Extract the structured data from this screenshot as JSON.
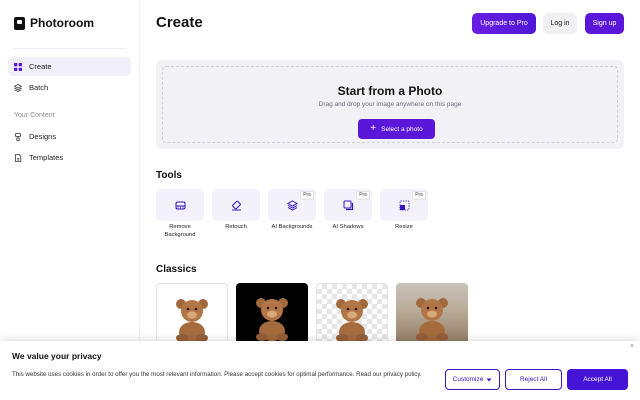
{
  "app": {
    "name": "Photoroom"
  },
  "sidebar": {
    "items": [
      {
        "label": "Create",
        "icon": "grid-icon",
        "active": true
      },
      {
        "label": "Batch",
        "icon": "layers-icon",
        "active": false
      }
    ],
    "section_label": "Your Content",
    "content_items": [
      {
        "label": "Designs",
        "icon": "designs-icon"
      },
      {
        "label": "Templates",
        "icon": "templates-icon"
      }
    ]
  },
  "header": {
    "title": "Create",
    "upgrade_label": "Upgrade to Pro",
    "login_label": "Log in",
    "signup_label": "Sign up"
  },
  "upload": {
    "title": "Start from a Photo",
    "subtitle": "Drag and drop your image anywhere on this page",
    "button_label": "Select a photo",
    "button_icon": "plus-icon"
  },
  "tools": {
    "title": "Tools",
    "pro_label": "Pro",
    "items": [
      {
        "label_line1": "Remove",
        "label_line2": "Background",
        "icon": "remove-background-icon",
        "pro": false
      },
      {
        "label_line1": "Retouch",
        "label_line2": "",
        "icon": "retouch-icon",
        "pro": false
      },
      {
        "label_line1": "AI Backgrounds",
        "label_line2": "",
        "icon": "ai-backgrounds-icon",
        "pro": true
      },
      {
        "label_line1": "AI Shadows",
        "label_line2": "",
        "icon": "ai-shadows-icon",
        "pro": true
      },
      {
        "label_line1": "Resize",
        "label_line2": "",
        "icon": "resize-icon",
        "pro": true
      }
    ]
  },
  "classics": {
    "title": "Classics",
    "items": [
      {
        "name": "white-background"
      },
      {
        "name": "black-background"
      },
      {
        "name": "transparent-background"
      },
      {
        "name": "blurred-background"
      }
    ]
  },
  "cookie": {
    "title": "We value your privacy",
    "text": "This website uses cookies in order to offer you the most relevant information. Please accept cookies for optimal performance. Read our privacy policy.",
    "customize_label": "Customize",
    "reject_label": "Reject All",
    "accept_label": "Accept All",
    "close_label": "×"
  },
  "colors": {
    "accent": "#5a16d9",
    "sidebar_active": "#f1effa",
    "tool_bg": "#f3f2fa"
  }
}
